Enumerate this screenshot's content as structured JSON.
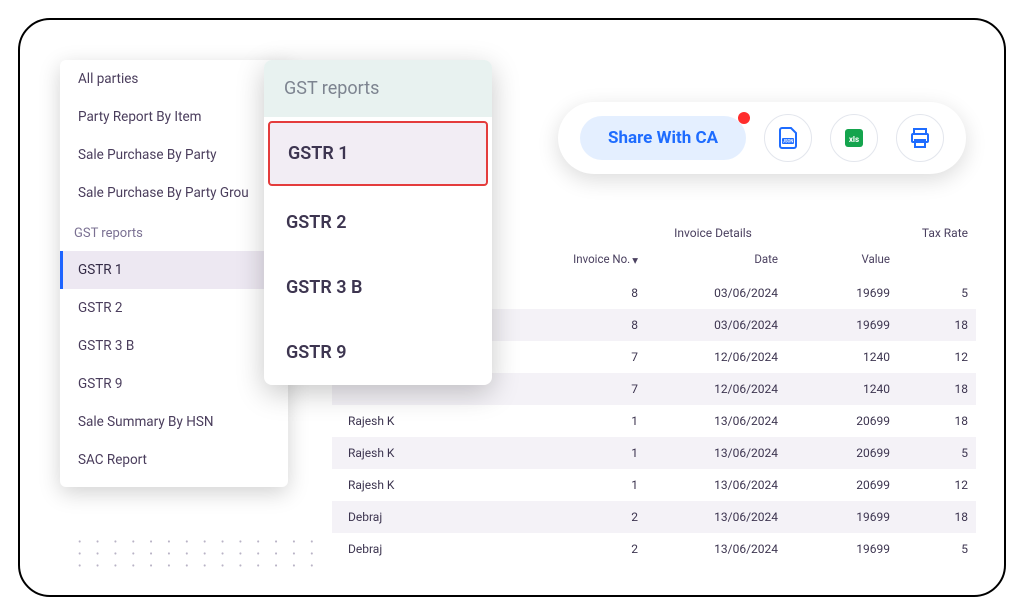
{
  "sidebar": {
    "top_items": [
      "All parties",
      "Party Report By Item",
      "Sale Purchase By Party",
      "Sale Purchase By Party Grou"
    ],
    "section_header": "GST reports",
    "reports": [
      "GSTR 1",
      "GSTR 2",
      "GSTR 3 B",
      "GSTR 9",
      "Sale Summary By HSN",
      "SAC Report"
    ],
    "active_index": 0
  },
  "popup": {
    "title": "GST reports",
    "items": [
      "GSTR 1",
      "GSTR 2",
      "GSTR 3 B",
      "GSTR 9"
    ],
    "selected_index": 0
  },
  "toolbar": {
    "share_label": "Share With CA",
    "icons": {
      "json": "json-file-icon",
      "xls": "xls-file-icon",
      "print": "print-icon"
    }
  },
  "table": {
    "super_headers": {
      "invoice": "Invoice Details",
      "tax": "Tax Rate"
    },
    "columns": {
      "invoice_no": "Invoice No.",
      "date": "Date",
      "value": "Value"
    },
    "rows": [
      {
        "name": "",
        "invoice_no": "8",
        "date": "03/06/2024",
        "value": "19699",
        "tax": "5"
      },
      {
        "name": "",
        "invoice_no": "8",
        "date": "03/06/2024",
        "value": "19699",
        "tax": "18"
      },
      {
        "name": "",
        "invoice_no": "7",
        "date": "12/06/2024",
        "value": "1240",
        "tax": "12"
      },
      {
        "name": "",
        "invoice_no": "7",
        "date": "12/06/2024",
        "value": "1240",
        "tax": "18"
      },
      {
        "name": "Rajesh K",
        "invoice_no": "1",
        "date": "13/06/2024",
        "value": "20699",
        "tax": "18"
      },
      {
        "name": "Rajesh K",
        "invoice_no": "1",
        "date": "13/06/2024",
        "value": "20699",
        "tax": "5"
      },
      {
        "name": "Rajesh K",
        "invoice_no": "1",
        "date": "13/06/2024",
        "value": "20699",
        "tax": "12"
      },
      {
        "name": "Debraj",
        "invoice_no": "2",
        "date": "13/06/2024",
        "value": "19699",
        "tax": "18"
      },
      {
        "name": "Debraj",
        "invoice_no": "2",
        "date": "13/06/2024",
        "value": "19699",
        "tax": "5"
      }
    ]
  }
}
